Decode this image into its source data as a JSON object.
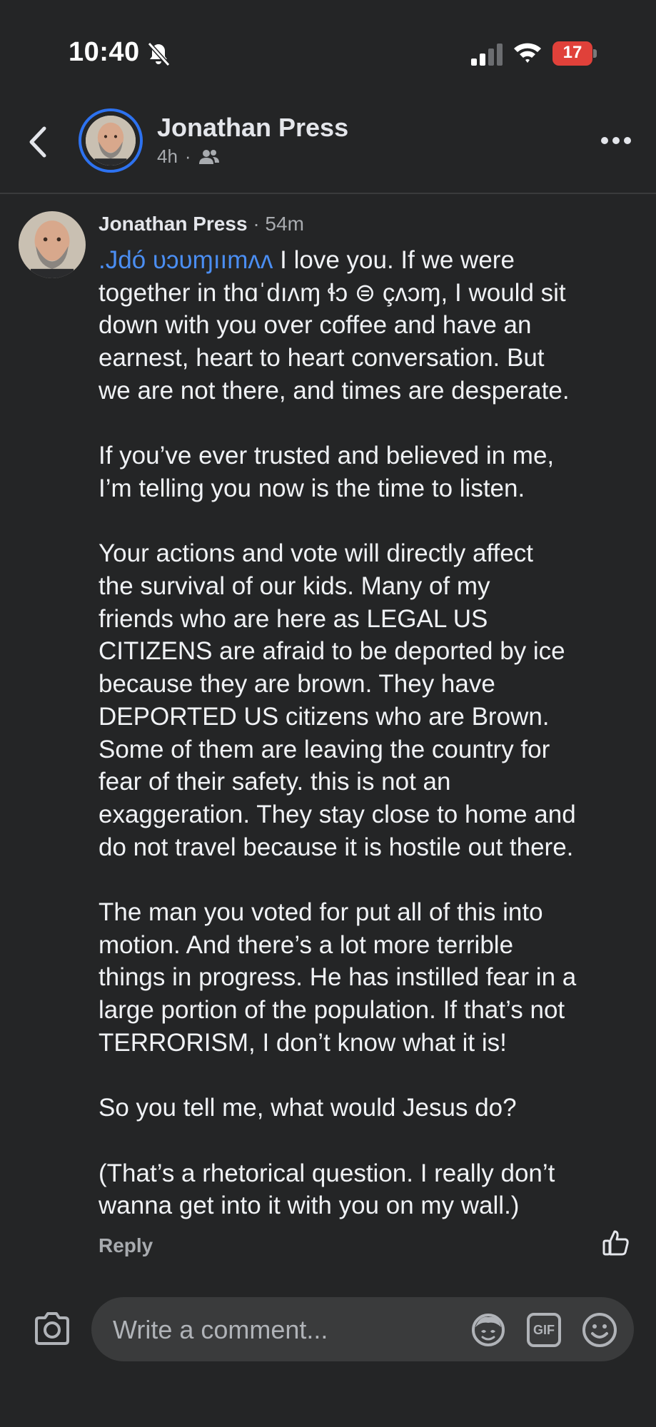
{
  "status_bar": {
    "time": "10:40",
    "battery": "17"
  },
  "header": {
    "name": "Jonathan Press",
    "time_ago": "4h",
    "dot": "·"
  },
  "comment": {
    "author": "Jonathan Press",
    "dot": "·",
    "time_ago": "54m",
    "garbled_line1_prefix": ".Jdó υɔυɱıımʌʌ",
    "garbled_line1_rest": " I love you. If we were",
    "garbled_line2_prefix": "together in th",
    "garbled_line2_mid": "ɑˈdıʌɱ ɬɔ ⊜ çʌɔɱ,",
    "garbled_line2_rest": " I would sit",
    "p1": "down with you over coffee and have an\nearnest, heart to heart  conversation. But\nwe are not there, and times are desperate.",
    "p2": "If you’ve ever trusted and believed in me,\nI’m telling you now is the time to listen.",
    "p3": "Your actions and vote will directly affect\nthe survival of our kids.  Many of my\nfriends who are here as LEGAL US\nCITIZENS are afraid to be deported by ice\nbecause they are brown. They have\nDEPORTED US citizens who are Brown.\nSome of them are leaving the country for\nfear of their safety.  this is not an\nexaggeration. They stay close to home and\ndo not travel because it is hostile out there.",
    "p4": "The man you voted for put all of this into\nmotion. And there’s a lot more terrible\nthings in progress.  He has instilled fear in a\nlarge portion of the population. If that’s not\nTERRORISM, I don’t know what it is!",
    "p5": "So you tell me, what would Jesus do?",
    "p6": "(That’s a rhetorical question. I really don’t\nwanna get into it with you on my wall.)",
    "reply_label": "Reply"
  },
  "composer": {
    "placeholder": "Write a comment...",
    "gif_label": "GIF"
  },
  "colors": {
    "background": "#242526",
    "accent_ring": "#2d72f0",
    "battery_low": "#e0413a",
    "input_bg": "#3a3b3c",
    "secondary_text": "#a8abaf"
  },
  "icons": [
    "bell-slash-icon",
    "signal-icon",
    "wifi-icon",
    "battery-icon",
    "back-chevron-icon",
    "friends-audience-icon",
    "more-icon",
    "like-icon",
    "camera-icon",
    "avatar-sticker-icon",
    "gif-icon",
    "emoji-icon"
  ]
}
